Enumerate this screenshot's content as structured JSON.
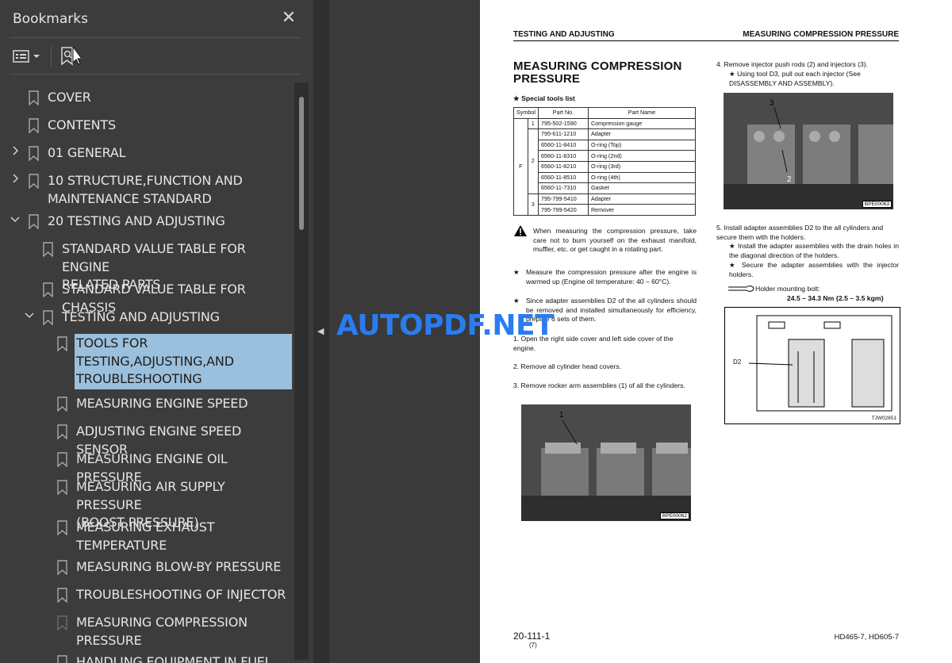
{
  "bookmarks_panel": {
    "title": "Bookmarks",
    "close_glyph": "✕",
    "items": [
      {
        "label": "COVER",
        "level": 0,
        "expander": ""
      },
      {
        "label": "CONTENTS",
        "level": 0,
        "expander": ""
      },
      {
        "label": "01 GENERAL",
        "level": 0,
        "expander": "collapsed"
      },
      {
        "label": "10 STRUCTURE,FUNCTION AND\nMAINTENANCE STANDARD",
        "level": 0,
        "expander": "collapsed"
      },
      {
        "label": "20 TESTING AND ADJUSTING",
        "level": 0,
        "expander": "expanded"
      },
      {
        "label": "STANDARD VALUE TABLE FOR ENGINE\nRELATED PARTS",
        "level": 1,
        "expander": ""
      },
      {
        "label": "STANDARD VALUE TABLE FOR CHASSIS",
        "level": 1,
        "expander": ""
      },
      {
        "label": "TESTING AND ADJUSTING",
        "level": 1,
        "expander": "expanded"
      },
      {
        "label": "TOOLS FOR\nTESTING,ADJUSTING,AND\nTROUBLESHOOTING",
        "level": 2,
        "expander": "",
        "selected": true
      },
      {
        "label": "MEASURING ENGINE SPEED",
        "level": 2,
        "expander": ""
      },
      {
        "label": "ADJUSTING ENGINE SPEED SENSOR",
        "level": 2,
        "expander": ""
      },
      {
        "label": "MEASURING ENGINE OIL PRESSURE",
        "level": 2,
        "expander": ""
      },
      {
        "label": "MEASURING AIR SUPPLY PRESSURE\n(BOOST PRESSURE)",
        "level": 2,
        "expander": ""
      },
      {
        "label": "MEASURING EXHAUST\nTEMPERATURE",
        "level": 2,
        "expander": ""
      },
      {
        "label": "MEASURING BLOW-BY PRESSURE",
        "level": 2,
        "expander": ""
      },
      {
        "label": "TROUBLESHOOTING OF INJECTOR",
        "level": 2,
        "expander": ""
      },
      {
        "label": "MEASURING COMPRESSION\nPRESSURE",
        "level": 2,
        "expander": ""
      },
      {
        "label": "HANDLING EQUIPMENT IN FUEL",
        "level": 2,
        "expander": ""
      }
    ]
  },
  "watermark": "AUTOPDF.NET",
  "page": {
    "header_left": "TESTING AND ADJUSTING",
    "header_right": "MEASURING COMPRESSION PRESSURE",
    "title_line1": "MEASURING COMPRESSION",
    "title_line2": "PRESSURE",
    "tools_heading": "★  Special tools list",
    "tools_table": {
      "headers": [
        "Symbol",
        "",
        "Part No.",
        "Part Name"
      ],
      "symbol": "F",
      "rows": [
        [
          "1",
          "795-502-1590",
          "Compression gauge"
        ],
        [
          "",
          "795-611-1210",
          "Adapter"
        ],
        [
          "",
          "6560-11-8410",
          "O-ring (Top)"
        ],
        [
          "2",
          "6560-11-8310",
          "O-ring (2nd)"
        ],
        [
          "",
          "6560-11-8210",
          "O-ring (3rd)"
        ],
        [
          "",
          "6560-11-8510",
          "O-ring (4th)"
        ],
        [
          "",
          "6560-11-7310",
          "Gasket"
        ],
        [
          "3",
          "795-799-5410",
          "Adapter"
        ],
        [
          "",
          "795-799-5420",
          "Remover"
        ]
      ]
    },
    "warning": "When measuring the compression pressure, take care not to burn yourself on the exhaust manifold, muffler, etc. or get caught in a rotating part.",
    "note1": "Measure the compression pressure after the engine is warmed up (Engine oil temperature: 40 – 60°C).",
    "note2": "Since adapter assemblies D2 of the all cylinders should be removed and installed simultaneously for efficiency, prepare 6 sets of them.",
    "step1": "1.  Open the right side cover and left side cover of the engine.",
    "step2": "2.  Remove all cylinder head covers.",
    "step3": "3.  Remove rocker arm assemblies (1) of all the cylinders.",
    "step4": "4.  Remove injector push rods (2) and injectors (3).",
    "step4_note": "★  Using tool D3, pull out each injector (See DISASSEMBLY AND ASSEMBLY).",
    "step5": "5.  Install adapter assemblies D2 to the all cylinders and secure them with the holders.",
    "step5_note1": "★  Install the adapter assemblies with the drain holes in the diagonal direction of the holders.",
    "step5_note2": "★  Secure the adapter assemblies with the injector holders.",
    "bolt_label": "Holder mounting bolt:",
    "bolt_value": "24.5 – 34.3 Nm {2.5 – 3.5 kgm}",
    "photo1_tag": "BPE00062",
    "photo1_callout": "1",
    "photo2_tag": "BPE00063",
    "photo2_callout_a": "3",
    "photo2_callout_b": "2",
    "diagram_tag": "TJW02851",
    "diagram_callout": "D2",
    "page_number": "20-111-1",
    "page_sub": "(7)",
    "model": "HD465-7, HD605-7"
  }
}
